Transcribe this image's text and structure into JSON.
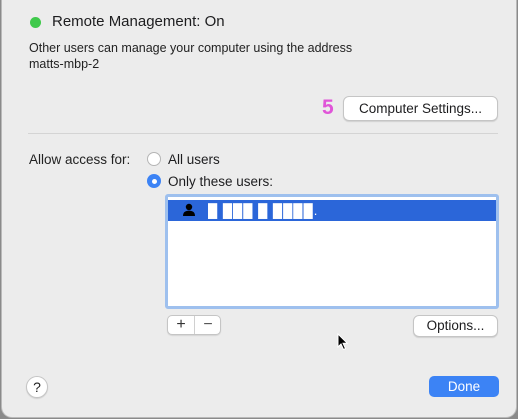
{
  "status": {
    "title": "Remote Management: On",
    "color": "#3fc94b"
  },
  "description": {
    "line1": "Other users can manage your computer using the address",
    "line2": "matts-mbp-2"
  },
  "annotation": {
    "step": "5",
    "color": "#e055d8"
  },
  "buttons": {
    "computer_settings": "Computer Settings...",
    "options": "Options...",
    "done": "Done",
    "help": "?",
    "add": "+",
    "remove": "−"
  },
  "access": {
    "label": "Allow access for:",
    "options": [
      {
        "label": "All users",
        "selected": false
      },
      {
        "label": "Only these users:",
        "selected": true
      }
    ]
  },
  "users": [
    {
      "name": "█ ███ █ ████.",
      "icon": "person-icon",
      "selected": true
    }
  ],
  "colors": {
    "accent": "#3c83f5",
    "selection": "#2b66d9"
  }
}
